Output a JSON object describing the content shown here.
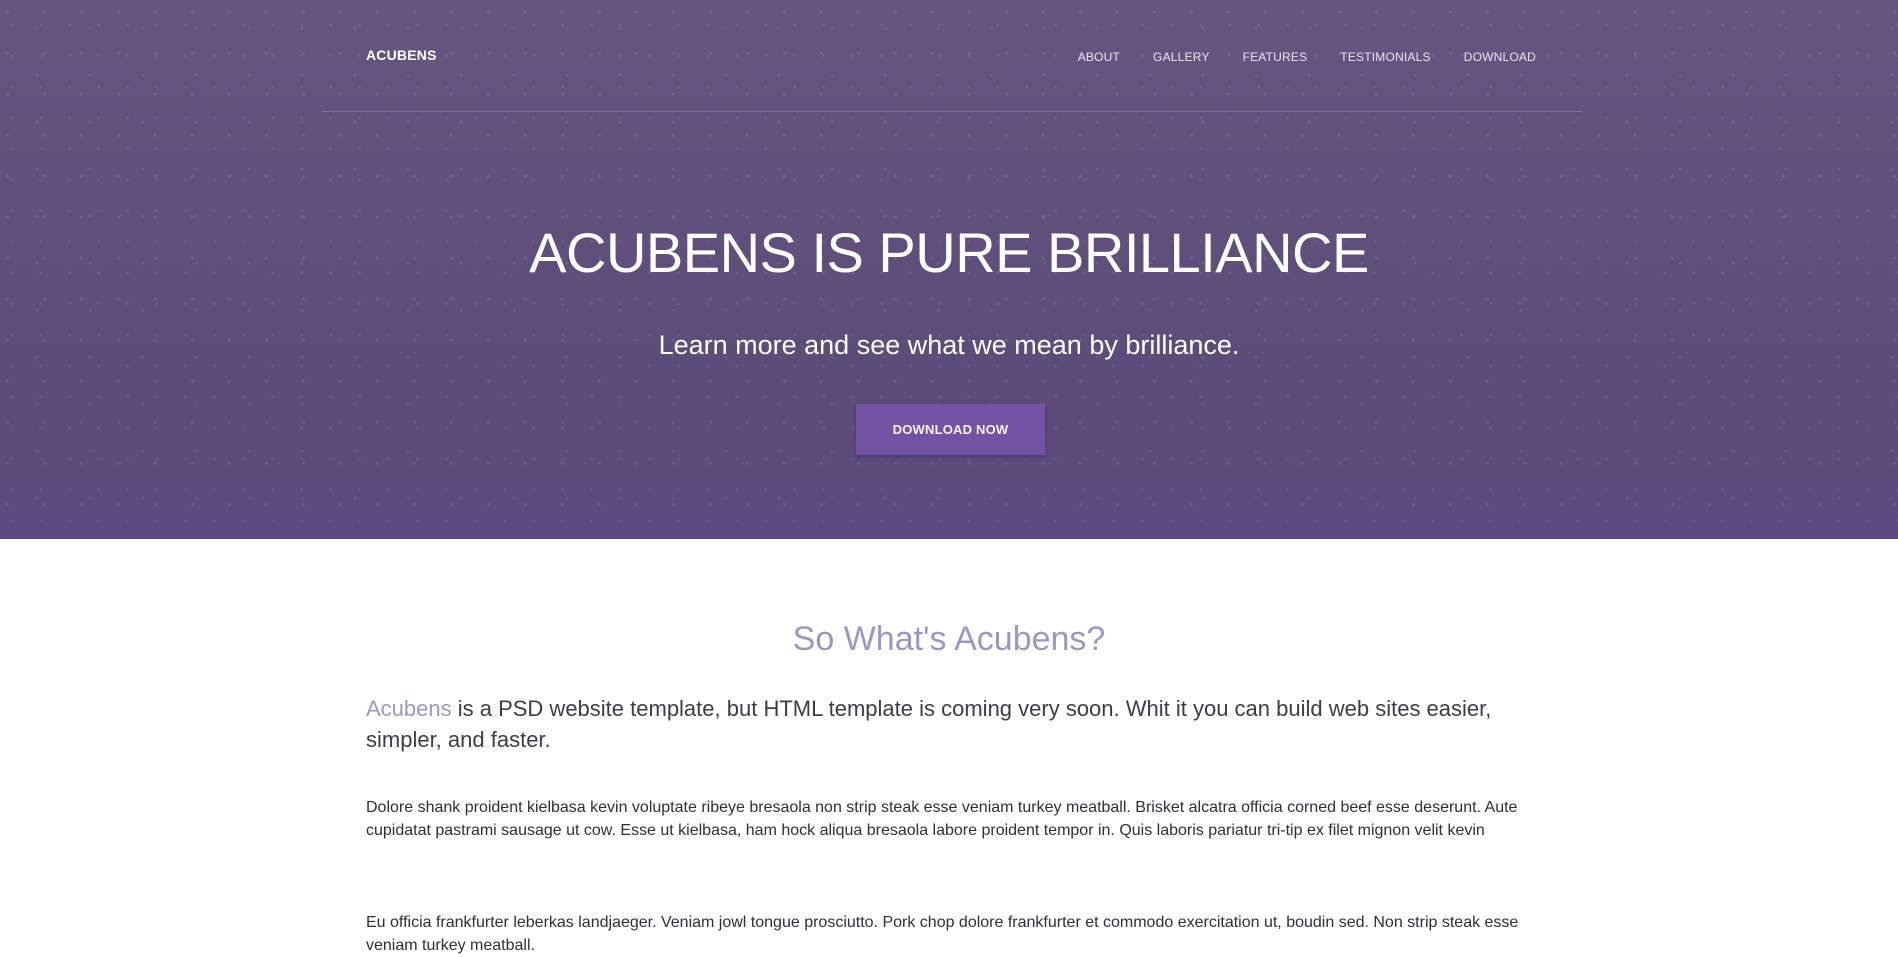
{
  "header": {
    "brand": "ACUBENS",
    "nav": [
      {
        "label": "ABOUT"
      },
      {
        "label": "GALLERY"
      },
      {
        "label": "FEATURES"
      },
      {
        "label": "TESTIMONIALS"
      },
      {
        "label": "DOWNLOAD"
      }
    ]
  },
  "hero": {
    "title": "ACUBENS IS PURE BRILLIANCE",
    "subtitle": "Learn more and see what we mean by brilliance.",
    "button_label": "DOWNLOAD NOW"
  },
  "about": {
    "title": "So What's Acubens?",
    "lead_highlight": "Acubens",
    "lead_text": " is a PSD website template, but HTML template is coming very soon. Whit it you can build web sites easier, simpler, and faster.",
    "paragraphs": [
      "Dolore shank proident kielbasa kevin voluptate ribeye bresaola non strip steak esse veniam turkey meatball. Brisket alcatra officia corned beef esse deserunt. Aute cupidatat pastrami sausage ut cow. Esse ut kielbasa, ham hock aliqua bresaola labore proident tempor in. Quis laboris pariatur tri-tip ex filet mignon velit kevin",
      "Eu officia frankfurter leberkas landjaeger. Veniam jowl tongue prosciutto. Pork chop dolore frankfurter et commodo exercitation ut, boudin sed. Non strip steak esse veniam turkey meatball."
    ]
  },
  "colors": {
    "hero_bg": "#5f4f7c",
    "button_bg": "#7452a5",
    "accent": "#9f95c6",
    "text": "#2f2f38"
  }
}
